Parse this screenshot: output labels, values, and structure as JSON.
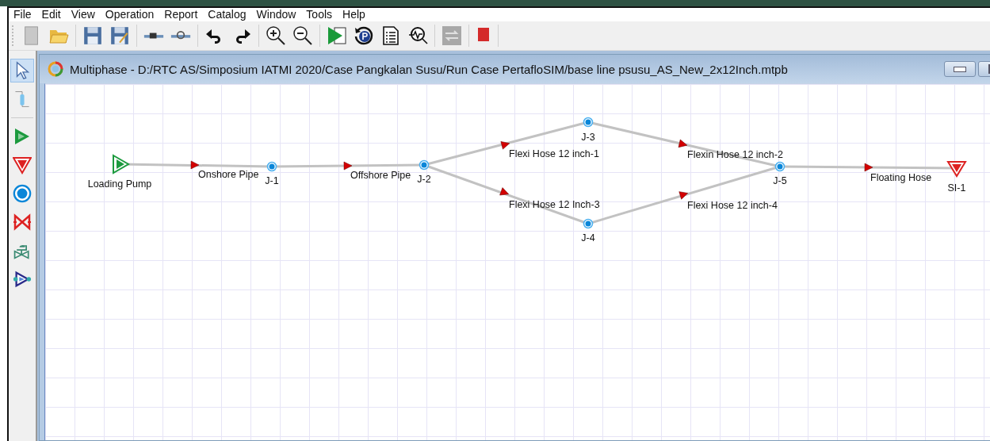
{
  "menu": [
    "File",
    "Edit",
    "View",
    "Operation",
    "Report",
    "Catalog",
    "Window",
    "Tools",
    "Help"
  ],
  "palette": [
    {
      "kind": "pointer",
      "selected": true
    },
    {
      "kind": "pipe",
      "selected": false
    },
    {
      "kind": "source",
      "selected": false
    },
    {
      "kind": "sink",
      "selected": false
    },
    {
      "kind": "junction",
      "selected": false
    },
    {
      "kind": "valve",
      "selected": false
    },
    {
      "kind": "control-valve",
      "selected": false
    },
    {
      "kind": "pump",
      "selected": false
    }
  ],
  "window": {
    "title": "Multiphase - D:/RTC AS/Simposium IATMI 2020/Case Pangkalan Susu/Run Case PertafloSIM/base line psusu_AS_New_2x12Inch.mtpb"
  },
  "diagram": {
    "nodes": [
      {
        "kind": "source",
        "label": "Loading Pump"
      },
      {
        "kind": "junction",
        "label": "J-1"
      },
      {
        "kind": "junction",
        "label": "J-2"
      },
      {
        "kind": "junction",
        "label": "J-3"
      },
      {
        "kind": "junction",
        "label": "J-4"
      },
      {
        "kind": "junction",
        "label": "J-5"
      },
      {
        "kind": "sink",
        "label": "SI-1"
      }
    ],
    "pipes": [
      {
        "label": "Onshore Pipe"
      },
      {
        "label": "Offshore Pipe"
      },
      {
        "label": "Flexi Hose 12 inch-1"
      },
      {
        "label": "Flexin Hose 12 inch-2"
      },
      {
        "label": "Flexi Hose 12 Inch-3"
      },
      {
        "label": "Flexi Hose 12 inch-4"
      },
      {
        "label": "Floating Hose"
      }
    ]
  }
}
